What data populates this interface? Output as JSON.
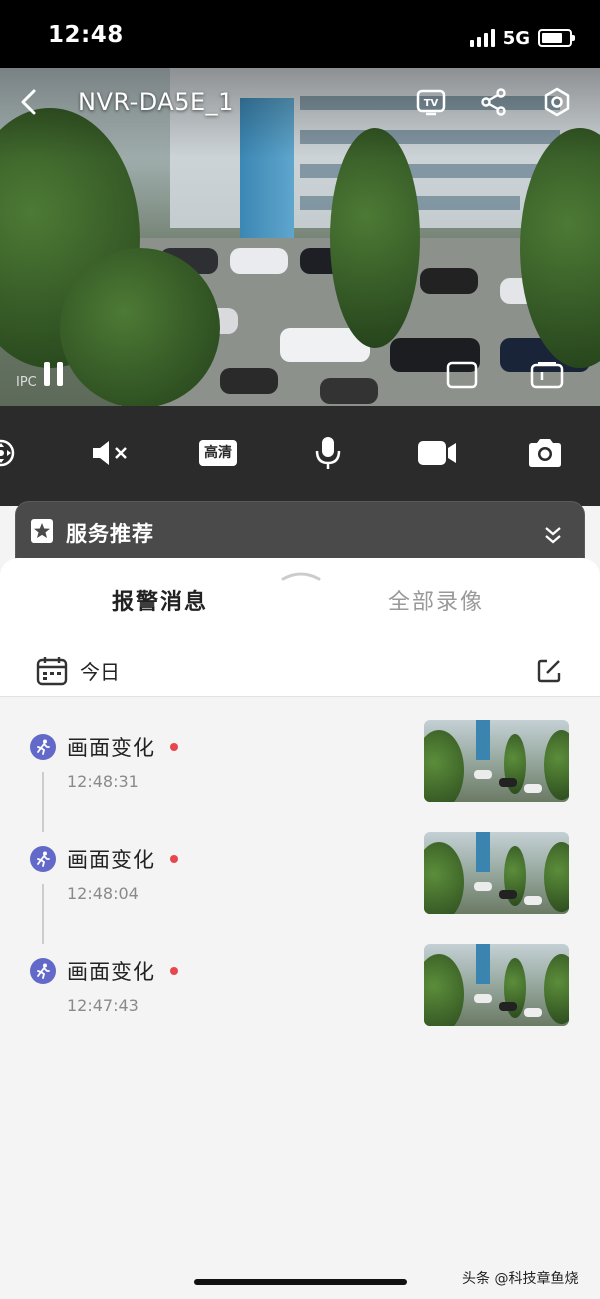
{
  "status_bar": {
    "time": "12:48",
    "network": "5G"
  },
  "video": {
    "title": "NVR-DA5E_1",
    "channel_tag": "IPC",
    "icons": [
      "back-icon",
      "tv-icon",
      "share-icon",
      "settings-icon",
      "pause-icon",
      "fullscreen-icon",
      "multi-screen-icon"
    ]
  },
  "toolbar": {
    "quality_label": "高清",
    "icons": [
      "ptz-icon",
      "mute-icon",
      "quality-icon",
      "microphone-icon",
      "record-icon",
      "camera-icon"
    ]
  },
  "service": {
    "label": "服务推荐"
  },
  "sheet": {
    "tabs": [
      {
        "label": "报警消息",
        "active": true
      },
      {
        "label": "全部录像",
        "active": false
      }
    ],
    "date_filter": "今日"
  },
  "alerts": [
    {
      "title": "画面变化",
      "time": "12:48:31",
      "unread": true
    },
    {
      "title": "画面变化",
      "time": "12:48:04",
      "unread": true
    },
    {
      "title": "画面变化",
      "time": "12:47:43",
      "unread": true
    }
  ],
  "watermark": "头条 @科技章鱼烧",
  "colors": {
    "accent": "#6269c9",
    "unread_dot": "#e5484d",
    "toolbar_bg": "#2b2b2b"
  }
}
